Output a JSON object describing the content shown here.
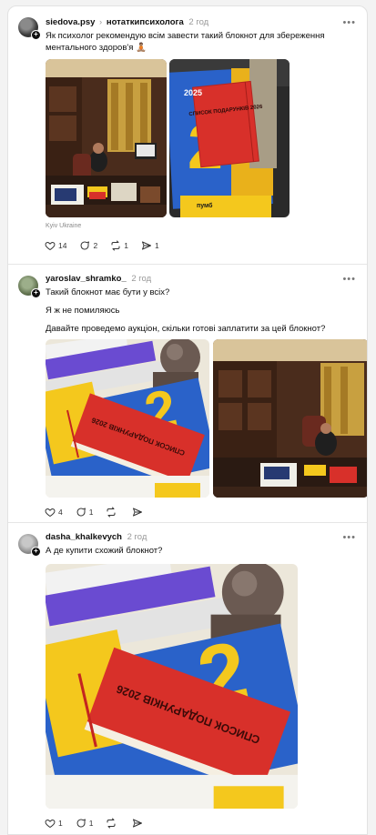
{
  "posts": [
    {
      "username": "siedova.psy",
      "topic": "нотаткипсихолога",
      "time": "2 год",
      "text": "Як психолог рекомендую всім завести такий блокнот для збереження ментального здоров'я 🧘🏽",
      "location": "Kyiv Ukraine",
      "likes": "14",
      "replies": "2",
      "reposts": "1",
      "shares": "1",
      "images": [
        "office-desk-photo",
        "red-notebook-photo"
      ],
      "notebook": {
        "year_badge": "2025",
        "title": "СПИСОК ПОДАРУНКІВ 2026",
        "bank": "пумб"
      }
    },
    {
      "username": "yaroslav_shramko_",
      "time": "2 год",
      "lines": [
        "Такий блокнот має бути у всіх?",
        "Я ж не помиляюсь",
        "Давайте проведемо аукціон, скільки готові заплатити за цей блокнот?"
      ],
      "likes": "4",
      "replies": "1",
      "images": [
        "red-notebook-closeup",
        "office-desk-photo"
      ],
      "notebook": {
        "title": "СПИСОК ПОДАРУНКІВ 2026"
      }
    },
    {
      "username": "dasha_khalkevych",
      "time": "2 год",
      "text": "А де купити схожий блокнот?",
      "likes": "1",
      "replies": "1",
      "images": [
        "red-notebook-closeup"
      ],
      "notebook": {
        "title": "СПИСОК ПОДАРУНКІВ 2026"
      }
    }
  ],
  "icons": {
    "like": "heart-icon",
    "reply": "comment-icon",
    "repost": "repost-icon",
    "share": "send-icon",
    "more": "more-icon",
    "follow": "plus-icon"
  },
  "colors": {
    "text": "#101010",
    "muted": "#999999",
    "notebook_red": "#d8302a",
    "cover_yellow": "#f4c81d",
    "cover_blue": "#2a62c9"
  }
}
